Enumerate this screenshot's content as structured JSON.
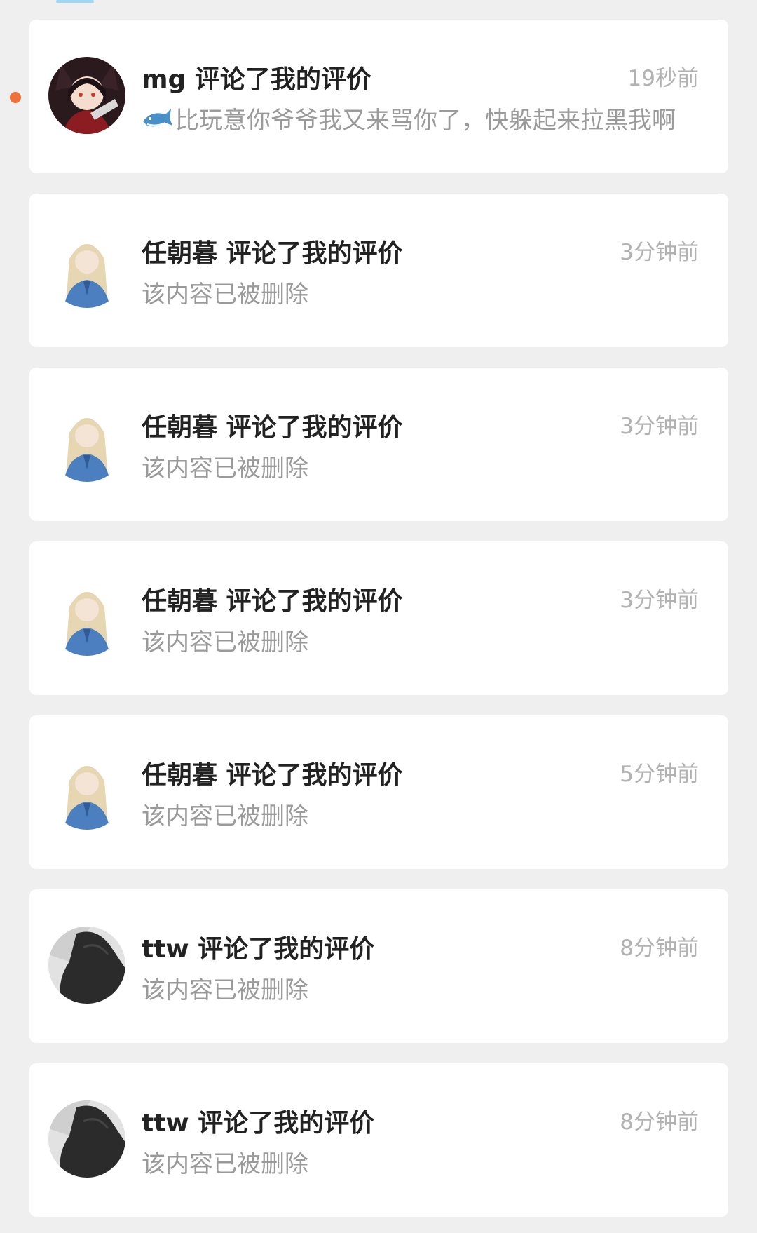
{
  "colors": {
    "background": "#efefef",
    "card": "#ffffff",
    "title_text": "#222222",
    "subtitle_text": "#9a9a9a",
    "time_text": "#b2b2b2",
    "unread_dot": "#f0703a",
    "tab_indicator": "#9fd6f3"
  },
  "notifications": [
    {
      "unread": true,
      "avatar": "fox-girl-avatar",
      "title": "mg 评论了我的评价",
      "emoji": "shark-emoji",
      "content": "比玩意你爷爷我又来骂你了，快躲起来拉黑我啊",
      "time": "19秒前"
    },
    {
      "unread": false,
      "avatar": "blonde-girl-avatar",
      "title": "任朝暮 评论了我的评价",
      "content": "该内容已被删除",
      "time": "3分钟前"
    },
    {
      "unread": false,
      "avatar": "blonde-girl-avatar",
      "title": "任朝暮 评论了我的评价",
      "content": "该内容已被删除",
      "time": "3分钟前"
    },
    {
      "unread": false,
      "avatar": "blonde-girl-avatar",
      "title": "任朝暮 评论了我的评价",
      "content": "该内容已被删除",
      "time": "3分钟前"
    },
    {
      "unread": false,
      "avatar": "blonde-girl-avatar",
      "title": "任朝暮 评论了我的评价",
      "content": "该内容已被删除",
      "time": "5分钟前"
    },
    {
      "unread": false,
      "avatar": "grey-photo-avatar",
      "title": "ttw 评论了我的评价",
      "content": "该内容已被删除",
      "time": "8分钟前"
    },
    {
      "unread": false,
      "avatar": "grey-photo-avatar",
      "title": "ttw 评论了我的评价",
      "content": "该内容已被删除",
      "time": "8分钟前"
    }
  ]
}
